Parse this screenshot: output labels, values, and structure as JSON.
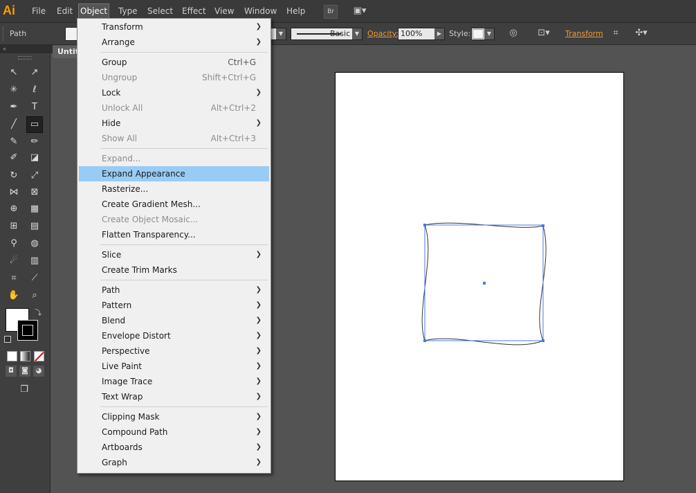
{
  "menubar": {
    "logo": "Ai",
    "items": [
      "File",
      "Edit",
      "Object",
      "Type",
      "Select",
      "Effect",
      "View",
      "Window",
      "Help"
    ],
    "bridge_label": "Br"
  },
  "controlbar": {
    "path_label": "Path",
    "stroke_profile": "Basic",
    "opacity_label": "Opacity:",
    "opacity_value": "100%",
    "style_label": "Style:",
    "transform_label": "Transform"
  },
  "document": {
    "tab_title": "Untitled"
  },
  "object_menu": {
    "items": [
      {
        "label": "Transform",
        "shortcut": "",
        "submenu": true,
        "disabled": false
      },
      {
        "label": "Arrange",
        "shortcut": "",
        "submenu": true,
        "disabled": false
      },
      {
        "label": "Group",
        "shortcut": "Ctrl+G",
        "submenu": false,
        "disabled": false
      },
      {
        "label": "Ungroup",
        "shortcut": "Shift+Ctrl+G",
        "submenu": false,
        "disabled": true
      },
      {
        "label": "Lock",
        "shortcut": "",
        "submenu": true,
        "disabled": false
      },
      {
        "label": "Unlock All",
        "shortcut": "Alt+Ctrl+2",
        "submenu": false,
        "disabled": true
      },
      {
        "label": "Hide",
        "shortcut": "",
        "submenu": true,
        "disabled": false
      },
      {
        "label": "Show All",
        "shortcut": "Alt+Ctrl+3",
        "submenu": false,
        "disabled": true
      },
      {
        "label": "Expand...",
        "shortcut": "",
        "submenu": false,
        "disabled": true
      },
      {
        "label": "Expand Appearance",
        "shortcut": "",
        "submenu": false,
        "disabled": false,
        "highlighted": true
      },
      {
        "label": "Rasterize...",
        "shortcut": "",
        "submenu": false,
        "disabled": false
      },
      {
        "label": "Create Gradient Mesh...",
        "shortcut": "",
        "submenu": false,
        "disabled": false
      },
      {
        "label": "Create Object Mosaic...",
        "shortcut": "",
        "submenu": false,
        "disabled": true
      },
      {
        "label": "Flatten Transparency...",
        "shortcut": "",
        "submenu": false,
        "disabled": false
      },
      {
        "label": "Slice",
        "shortcut": "",
        "submenu": true,
        "disabled": false
      },
      {
        "label": "Create Trim Marks",
        "shortcut": "",
        "submenu": false,
        "disabled": false
      },
      {
        "label": "Path",
        "shortcut": "",
        "submenu": true,
        "disabled": false
      },
      {
        "label": "Pattern",
        "shortcut": "",
        "submenu": true,
        "disabled": false
      },
      {
        "label": "Blend",
        "shortcut": "",
        "submenu": true,
        "disabled": false
      },
      {
        "label": "Envelope Distort",
        "shortcut": "",
        "submenu": true,
        "disabled": false
      },
      {
        "label": "Perspective",
        "shortcut": "",
        "submenu": true,
        "disabled": false
      },
      {
        "label": "Live Paint",
        "shortcut": "",
        "submenu": true,
        "disabled": false
      },
      {
        "label": "Image Trace",
        "shortcut": "",
        "submenu": true,
        "disabled": false
      },
      {
        "label": "Text Wrap",
        "shortcut": "",
        "submenu": true,
        "disabled": false
      },
      {
        "label": "Clipping Mask",
        "shortcut": "",
        "submenu": true,
        "disabled": false
      },
      {
        "label": "Compound Path",
        "shortcut": "",
        "submenu": true,
        "disabled": false
      },
      {
        "label": "Artboards",
        "shortcut": "",
        "submenu": true,
        "disabled": false
      },
      {
        "label": "Graph",
        "shortcut": "",
        "submenu": true,
        "disabled": false
      }
    ]
  },
  "colors": {
    "menu_highlight": "#99ccf5",
    "brand": "#ff9a00",
    "selection": "#4a78e0"
  }
}
